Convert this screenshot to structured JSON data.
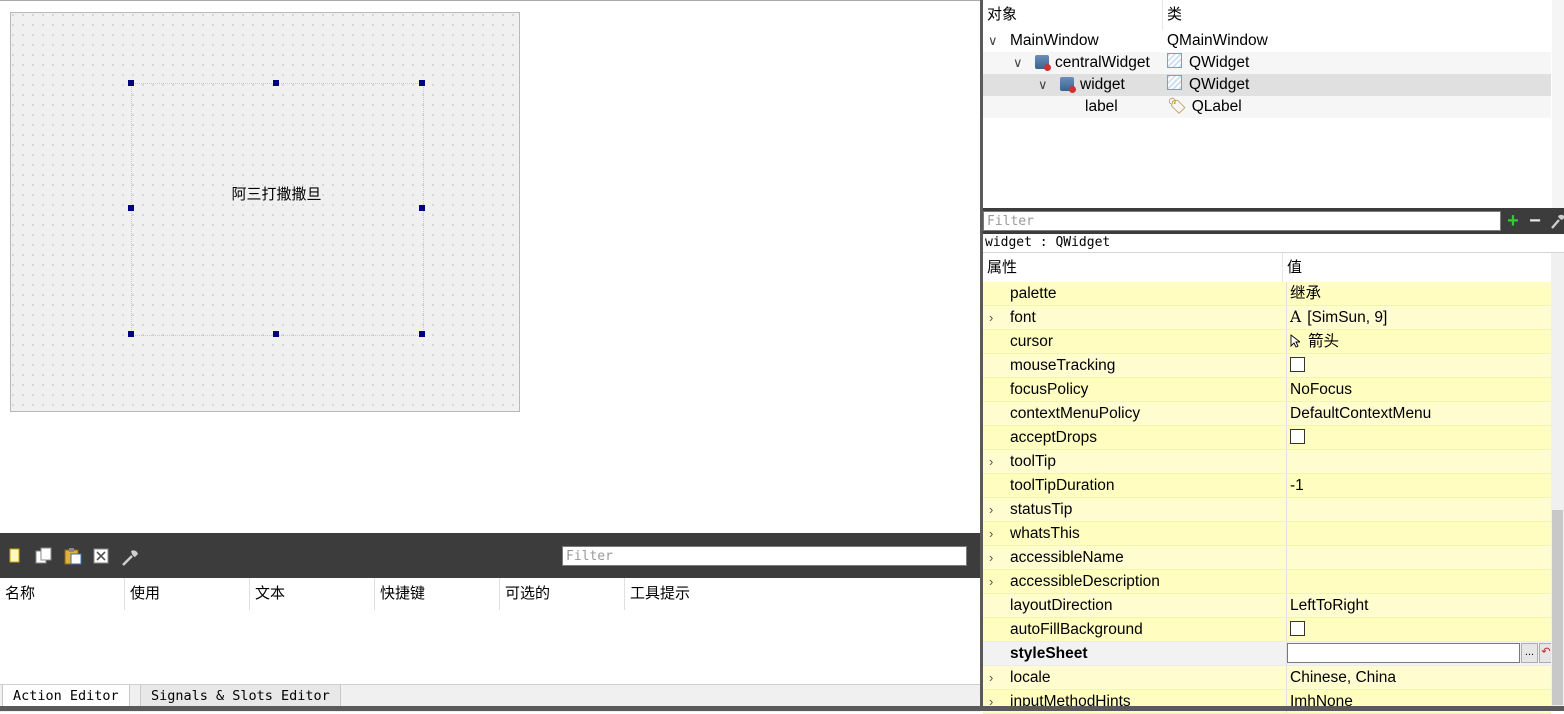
{
  "form": {
    "label_text": "阿三打撒撒旦"
  },
  "action_editor": {
    "toolbar_icons": [
      "new-action-icon",
      "copy-action-icon",
      "paste-action-icon",
      "delete-action-icon",
      "configure-icon"
    ],
    "filter_placeholder": "Filter",
    "columns": [
      "名称",
      "使用",
      "文本",
      "快捷键",
      "可选的",
      "工具提示"
    ]
  },
  "bottom_tabs": [
    "Action Editor",
    "Signals & Slots Editor"
  ],
  "object_inspector": {
    "header": {
      "object": "对象",
      "class": "类"
    },
    "rows": [
      {
        "name": "MainWindow",
        "class": "QMainWindow"
      },
      {
        "name": "centralWidget",
        "class": "QWidget"
      },
      {
        "name": "widget",
        "class": "QWidget"
      },
      {
        "name": "label",
        "class": "QLabel"
      }
    ]
  },
  "property_editor": {
    "filter_placeholder": "Filter",
    "add_label": "+",
    "remove_label": "−",
    "title": "widget : QWidget",
    "header": {
      "property": "属性",
      "value": "值"
    },
    "rows": [
      {
        "name": "palette",
        "value": "继承",
        "expandable": false
      },
      {
        "name": "font",
        "value": "[SimSun, 9]",
        "expandable": true,
        "icon": "font-icon"
      },
      {
        "name": "cursor",
        "value": "箭头",
        "expandable": false,
        "icon": "cursor-arrow-icon"
      },
      {
        "name": "mouseTracking",
        "value": "",
        "expandable": false,
        "type": "checkbox",
        "checked": false
      },
      {
        "name": "focusPolicy",
        "value": "NoFocus",
        "expandable": false
      },
      {
        "name": "contextMenuPolicy",
        "value": "DefaultContextMenu",
        "expandable": false
      },
      {
        "name": "acceptDrops",
        "value": "",
        "expandable": false,
        "type": "checkbox",
        "checked": false
      },
      {
        "name": "toolTip",
        "value": "",
        "expandable": true
      },
      {
        "name": "toolTipDuration",
        "value": "-1",
        "expandable": false
      },
      {
        "name": "statusTip",
        "value": "",
        "expandable": true
      },
      {
        "name": "whatsThis",
        "value": "",
        "expandable": true
      },
      {
        "name": "accessibleName",
        "value": "",
        "expandable": true
      },
      {
        "name": "accessibleDescription",
        "value": "",
        "expandable": true
      },
      {
        "name": "layoutDirection",
        "value": "LeftToRight",
        "expandable": false
      },
      {
        "name": "autoFillBackground",
        "value": "",
        "expandable": false,
        "type": "checkbox",
        "checked": false
      },
      {
        "name": "styleSheet",
        "value": "",
        "expandable": false,
        "type": "stylesheet",
        "button_label": "..."
      },
      {
        "name": "locale",
        "value": "Chinese, China",
        "expandable": true
      },
      {
        "name": "inputMethodHints",
        "value": "ImhNone",
        "expandable": true
      }
    ]
  },
  "colors": {
    "property_row_bg": "#fffec0",
    "dark_bar": "#3c3c3c",
    "handle": "#000080",
    "selection": "#e0e0e0"
  }
}
